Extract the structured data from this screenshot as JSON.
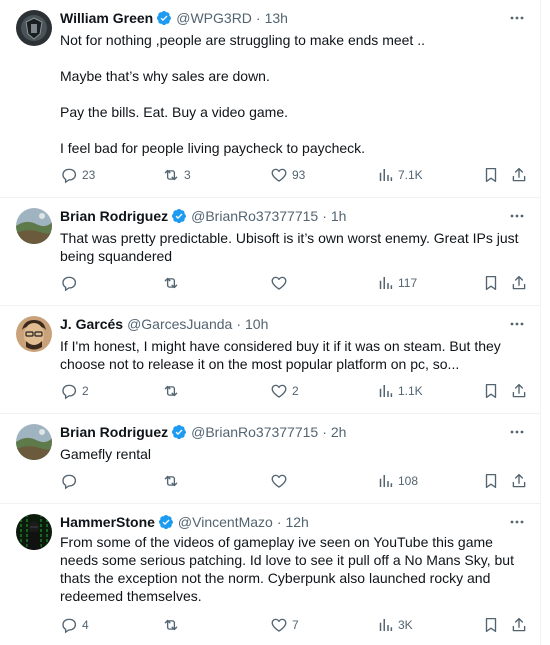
{
  "colors": {
    "verified": "#1d9bf0",
    "secondary_text": "#536471",
    "primary_text": "#0f1419",
    "divider": "#eff3f4"
  },
  "tweets": [
    {
      "name": "William Green",
      "handle": "@WPG3RD",
      "separator": "·",
      "time": "13h",
      "verified": true,
      "avatar_icon": "avatar-dark-shield-icon",
      "paragraphs": [
        "Not for nothing ,people are struggling to make ends meet ..",
        "Maybe that’s why sales are down.",
        "Pay the bills. Eat. Buy a video game.",
        "I feel bad for people living paycheck to paycheck."
      ],
      "counts": {
        "replies": "23",
        "reposts": "3",
        "likes": "93",
        "views": "7.1K"
      }
    },
    {
      "name": "Brian Rodriguez",
      "handle": "@BrianRo37377715",
      "separator": "·",
      "time": "1h",
      "verified": true,
      "avatar_icon": "avatar-landscape-icon",
      "paragraphs": [
        "That was pretty predictable. Ubisoft is it’s own worst enemy. Great IPs just being squandered"
      ],
      "counts": {
        "replies": "",
        "reposts": "",
        "likes": "",
        "views": "117"
      }
    },
    {
      "name": "J. Garcés",
      "handle": "@GarcesJuanda",
      "separator": "·",
      "time": "10h",
      "verified": false,
      "avatar_icon": "avatar-illustrated-face-icon",
      "paragraphs": [
        "If I'm honest, I might have considered buy it if it was on steam. But they choose not to release it on the most popular platform on pc, so..."
      ],
      "counts": {
        "replies": "2",
        "reposts": "",
        "likes": "2",
        "views": "1.1K"
      }
    },
    {
      "name": "Brian Rodriguez",
      "handle": "@BrianRo37377715",
      "separator": "·",
      "time": "2h",
      "verified": true,
      "avatar_icon": "avatar-landscape-icon",
      "paragraphs": [
        "Gamefly rental"
      ],
      "counts": {
        "replies": "",
        "reposts": "",
        "likes": "",
        "views": "108"
      }
    },
    {
      "name": "HammerStone",
      "handle": "@VincentMazo",
      "separator": "·",
      "time": "12h",
      "verified": true,
      "avatar_icon": "avatar-matrix-icon",
      "paragraphs": [
        "From some of the videos of gameplay ive seen on YouTube this game needs some serious patching.  Id love to see it pull off a No Mans Sky, but thats the exception not the norm.  Cyberpunk also launched rocky and redeemed themselves."
      ],
      "counts": {
        "replies": "4",
        "reposts": "",
        "likes": "7",
        "views": "3K"
      }
    }
  ]
}
